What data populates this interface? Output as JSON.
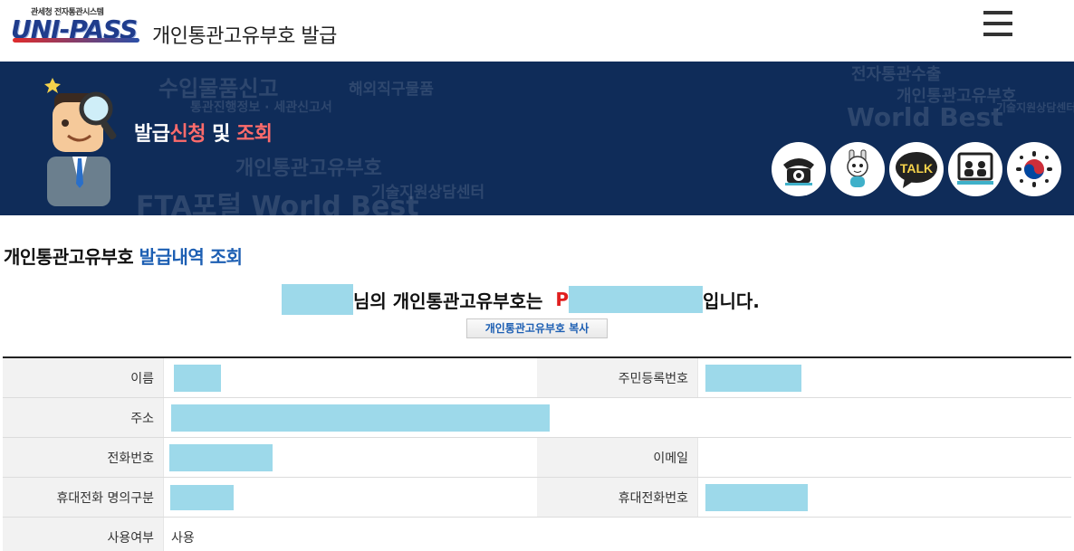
{
  "header": {
    "logo_sub": "관세청 전자통관시스템",
    "logo_main": "UNI-PASS",
    "title": "개인통관고유부호 발급",
    "menu_icon": "hamburger-menu-icon"
  },
  "banner": {
    "title_part1": "발급",
    "title_part2": "신청",
    "title_part3": " 및 ",
    "title_part4": "조회",
    "accent_color": "#ff6b6b",
    "background_color": "#0f2c59",
    "quick_icons": [
      "telephone-icon",
      "chatbot-icon",
      "talk-icon",
      "remote-support-icon",
      "government-emblem-icon"
    ],
    "talk_label": "TALK"
  },
  "section": {
    "title_black": "개인통관고유부호 ",
    "title_blue": "발급내역 조회"
  },
  "result": {
    "suffix_name": "님의 개인통관고유부호는",
    "code_prefix": "P",
    "suffix_end": "입니다.",
    "copy_button": "개인통관고유부호 복사"
  },
  "table": {
    "name_label": "이름",
    "rrn_label": "주민등록번호",
    "address_label": "주소",
    "phone_label": "전화번호",
    "email_label": "이메일",
    "mobile_owner_label": "휴대전화 명의구분",
    "mobile_label": "휴대전화번호",
    "usage_label": "사용여부",
    "usage_value": "사용"
  }
}
